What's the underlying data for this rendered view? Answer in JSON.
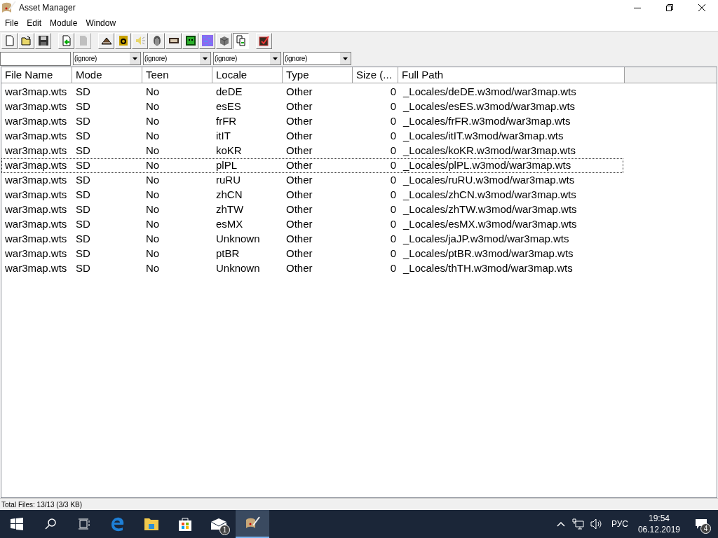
{
  "window": {
    "title": "Asset Manager"
  },
  "menu": [
    "File",
    "Edit",
    "Module",
    "Window"
  ],
  "toolbar": [
    {
      "kind": "new",
      "pressed": false,
      "disabled": false
    },
    {
      "kind": "open",
      "pressed": false,
      "disabled": false
    },
    {
      "kind": "save",
      "pressed": false,
      "disabled": false
    },
    {
      "kind": "sep"
    },
    {
      "kind": "import",
      "pressed": false,
      "disabled": false
    },
    {
      "kind": "export",
      "pressed": false,
      "disabled": true
    },
    {
      "kind": "sep"
    },
    {
      "kind": "terrain",
      "pressed": false,
      "disabled": false
    },
    {
      "kind": "font",
      "pressed": false,
      "disabled": false
    },
    {
      "kind": "sound",
      "pressed": false,
      "disabled": false
    },
    {
      "kind": "model",
      "pressed": false,
      "disabled": false
    },
    {
      "kind": "film",
      "pressed": false,
      "disabled": false
    },
    {
      "kind": "monster",
      "pressed": false,
      "disabled": false
    },
    {
      "kind": "texture",
      "pressed": false,
      "disabled": false
    },
    {
      "kind": "cube",
      "pressed": false,
      "disabled": false
    },
    {
      "kind": "copy",
      "pressed": true,
      "disabled": false
    },
    {
      "kind": "sep"
    },
    {
      "kind": "check",
      "pressed": false,
      "disabled": false
    }
  ],
  "filters": {
    "combos": [
      "(ignore)",
      "(ignore)",
      "(ignore)",
      "(ignore)"
    ]
  },
  "table": {
    "columns": [
      "File Name",
      "Mode",
      "Teen",
      "Locale",
      "Type",
      "Size (...",
      "Full Path"
    ],
    "rows": [
      {
        "cells": [
          "war3map.wts",
          "SD",
          "No",
          "deDE",
          "Other",
          "0",
          "_Locales/deDE.w3mod/war3map.wts"
        ],
        "focused": false
      },
      {
        "cells": [
          "war3map.wts",
          "SD",
          "No",
          "esES",
          "Other",
          "0",
          "_Locales/esES.w3mod/war3map.wts"
        ],
        "focused": false
      },
      {
        "cells": [
          "war3map.wts",
          "SD",
          "No",
          "frFR",
          "Other",
          "0",
          "_Locales/frFR.w3mod/war3map.wts"
        ],
        "focused": false
      },
      {
        "cells": [
          "war3map.wts",
          "SD",
          "No",
          "itIT",
          "Other",
          "0",
          "_Locales/itIT.w3mod/war3map.wts"
        ],
        "focused": false
      },
      {
        "cells": [
          "war3map.wts",
          "SD",
          "No",
          "koKR",
          "Other",
          "0",
          "_Locales/koKR.w3mod/war3map.wts"
        ],
        "focused": false
      },
      {
        "cells": [
          "war3map.wts",
          "SD",
          "No",
          "plPL",
          "Other",
          "0",
          "_Locales/plPL.w3mod/war3map.wts"
        ],
        "focused": true
      },
      {
        "cells": [
          "war3map.wts",
          "SD",
          "No",
          "ruRU",
          "Other",
          "0",
          "_Locales/ruRU.w3mod/war3map.wts"
        ],
        "focused": false
      },
      {
        "cells": [
          "war3map.wts",
          "SD",
          "No",
          "zhCN",
          "Other",
          "0",
          "_Locales/zhCN.w3mod/war3map.wts"
        ],
        "focused": false
      },
      {
        "cells": [
          "war3map.wts",
          "SD",
          "No",
          "zhTW",
          "Other",
          "0",
          "_Locales/zhTW.w3mod/war3map.wts"
        ],
        "focused": false
      },
      {
        "cells": [
          "war3map.wts",
          "SD",
          "No",
          "esMX",
          "Other",
          "0",
          "_Locales/esMX.w3mod/war3map.wts"
        ],
        "focused": false
      },
      {
        "cells": [
          "war3map.wts",
          "SD",
          "No",
          "Unknown",
          "Other",
          "0",
          "_Locales/jaJP.w3mod/war3map.wts"
        ],
        "focused": false
      },
      {
        "cells": [
          "war3map.wts",
          "SD",
          "No",
          "ptBR",
          "Other",
          "0",
          "_Locales/ptBR.w3mod/war3map.wts"
        ],
        "focused": false
      },
      {
        "cells": [
          "war3map.wts",
          "SD",
          "No",
          "Unknown",
          "Other",
          "0",
          "_Locales/thTH.w3mod/war3map.wts"
        ],
        "focused": false
      }
    ]
  },
  "status_bar": "Total Files: 13/13 (3/3 KB)",
  "taskbar": {
    "apps": [
      {
        "kind": "start",
        "active": false
      },
      {
        "kind": "search",
        "active": false
      },
      {
        "kind": "taskview",
        "active": false
      },
      {
        "kind": "edge",
        "active": false
      },
      {
        "kind": "explorer",
        "active": false
      },
      {
        "kind": "store",
        "active": false
      },
      {
        "kind": "mail",
        "active": false,
        "badge": "1"
      },
      {
        "kind": "scroll",
        "active": true
      }
    ],
    "language": "РУС",
    "time": "19:54",
    "date": "06.12.2019",
    "notifications": "4"
  }
}
